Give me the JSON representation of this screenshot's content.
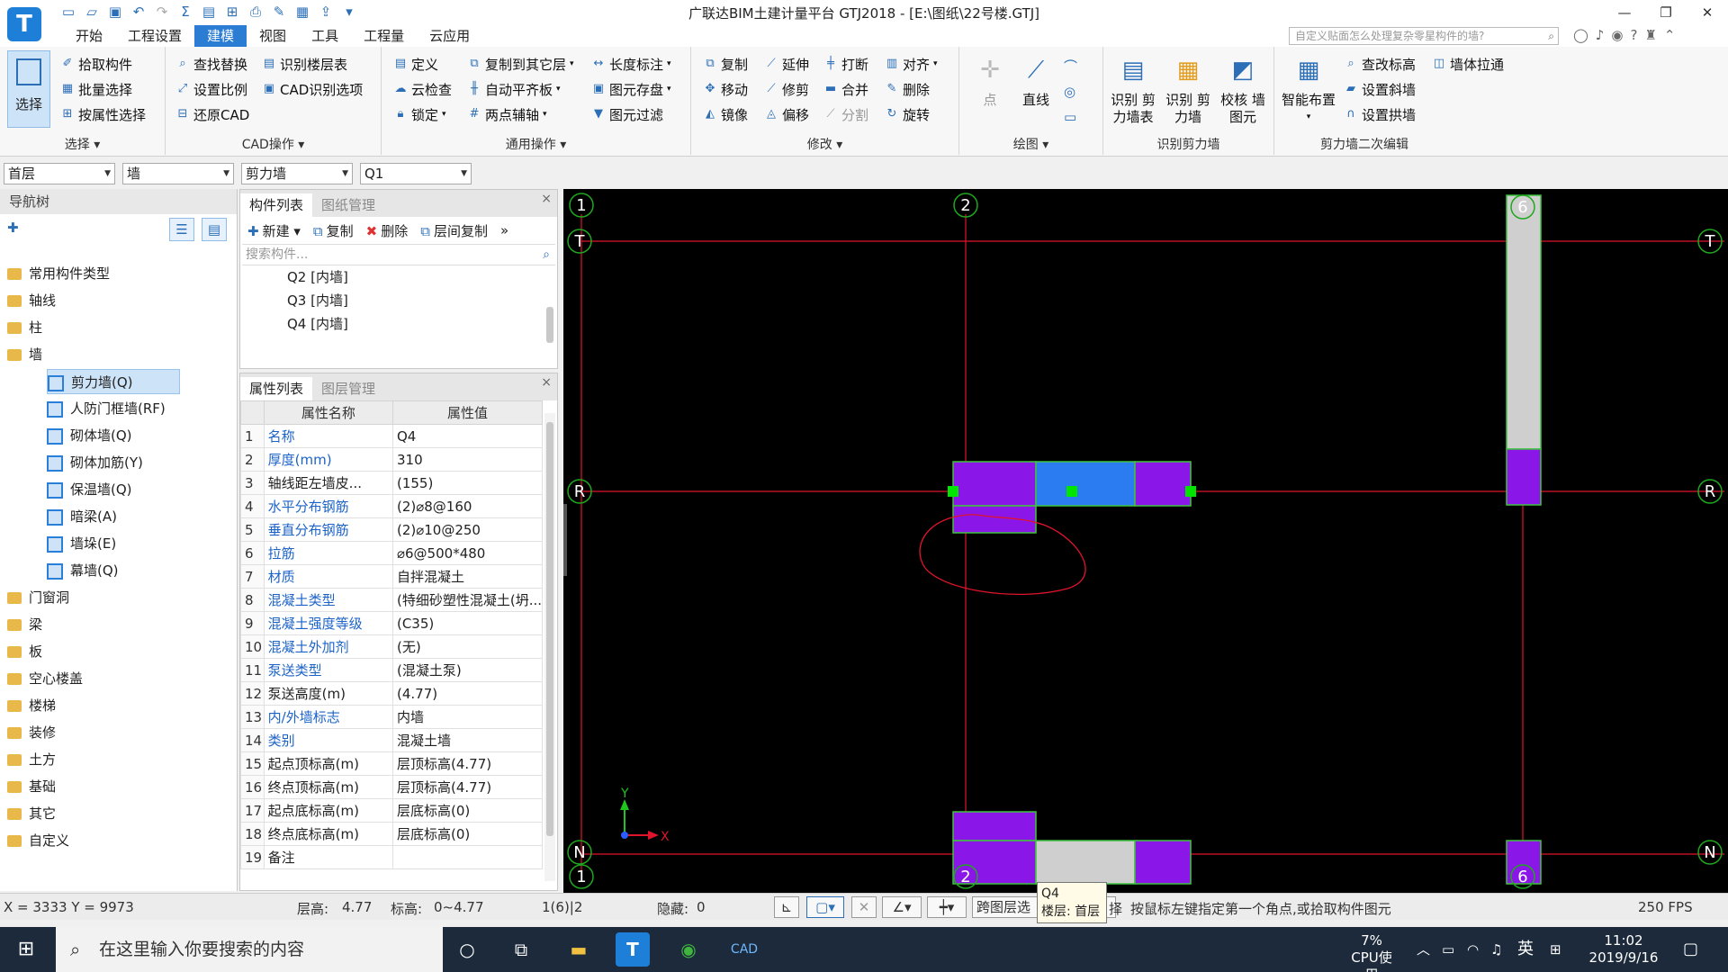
{
  "app": {
    "logo": "T",
    "title": "广联达BIM土建计量平台 GTJ2018 - [E:\\图纸\\22号楼.GTJ]",
    "window_controls": [
      "—",
      "❐",
      "✕"
    ]
  },
  "menu": {
    "tabs": [
      "开始",
      "工程设置",
      "建模",
      "视图",
      "工具",
      "工程量",
      "云应用"
    ],
    "active_tab": "建模",
    "help_placeholder": "自定义贴面怎么处理复杂零星构件的墙?",
    "help_question": "?"
  },
  "ribbon": {
    "select": {
      "big": "选择",
      "pick": "拾取构件",
      "batch": "批量选择",
      "byattr": "按属性选择",
      "label": "选择"
    },
    "cad": {
      "find": "查找替换",
      "scale": "设置比例",
      "restore": "还原CAD",
      "floor": "识别楼层表",
      "option": "CAD识别选项",
      "label": "CAD操作"
    },
    "common": {
      "define": "定义",
      "cloud": "云检查",
      "lock": "锁定",
      "copyto": "复制到其它层",
      "autoslab": "自动平齐板",
      "twopoint": "两点辅轴",
      "dim": "长度标注",
      "save": "图元存盘",
      "filter": "图元过滤",
      "label": "通用操作"
    },
    "modify": {
      "copy": "复制",
      "move": "移动",
      "mirror": "镜像",
      "extend": "延伸",
      "trim": "修剪",
      "offset": "偏移",
      "break": "打断",
      "merge": "合并",
      "split": "分割",
      "align": "对齐",
      "delete": "删除",
      "rotate": "旋转",
      "label": "修改"
    },
    "draw": {
      "point": "点",
      "line": "直线",
      "label": "绘图"
    },
    "recognize": {
      "table": "识别 剪力墙表",
      "wall": "识别 剪力墙",
      "check": "校核 墙图元",
      "label": "识别剪力墙"
    },
    "edit2": {
      "smart": "智能布置",
      "elev": "查改标高",
      "stretch": "墙体拉通",
      "slope": "设置斜墙",
      "arch": "设置拱墙",
      "label": "剪力墙二次编辑"
    }
  },
  "dropdowns": [
    "首层",
    "墙",
    "剪力墙",
    "Q1"
  ],
  "nav": {
    "header": "导航树",
    "items": [
      {
        "label": "常用构件类型",
        "type": "folder"
      },
      {
        "label": "轴线",
        "type": "folder"
      },
      {
        "label": "柱",
        "type": "folder"
      },
      {
        "label": "墙",
        "type": "folder"
      },
      {
        "label": "剪力墙(Q)",
        "type": "child",
        "selected": true
      },
      {
        "label": "人防门框墙(RF)",
        "type": "child"
      },
      {
        "label": "砌体墙(Q)",
        "type": "child"
      },
      {
        "label": "砌体加筋(Y)",
        "type": "child"
      },
      {
        "label": "保温墙(Q)",
        "type": "child"
      },
      {
        "label": "暗梁(A)",
        "type": "child"
      },
      {
        "label": "墙垛(E)",
        "type": "child"
      },
      {
        "label": "幕墙(Q)",
        "type": "child"
      },
      {
        "label": "门窗洞",
        "type": "folder"
      },
      {
        "label": "梁",
        "type": "folder"
      },
      {
        "label": "板",
        "type": "folder"
      },
      {
        "label": "空心楼盖",
        "type": "folder"
      },
      {
        "label": "楼梯",
        "type": "folder"
      },
      {
        "label": "装修",
        "type": "folder"
      },
      {
        "label": "土方",
        "type": "folder"
      },
      {
        "label": "基础",
        "type": "folder"
      },
      {
        "label": "其它",
        "type": "folder"
      },
      {
        "label": "自定义",
        "type": "folder"
      }
    ]
  },
  "components": {
    "tabs": [
      "构件列表",
      "图纸管理"
    ],
    "tools": [
      "新建",
      "复制",
      "删除",
      "层间复制"
    ],
    "search_placeholder": "搜索构件...",
    "items": [
      "Q2 [内墙]",
      "Q3 [内墙]",
      "Q4 [内墙]"
    ]
  },
  "properties": {
    "tabs": [
      "属性列表",
      "图层管理"
    ],
    "headers": [
      "属性名称",
      "属性值"
    ],
    "rows": [
      {
        "n": "1",
        "name": "名称",
        "value": "Q4",
        "blue": true
      },
      {
        "n": "2",
        "name": "厚度(mm)",
        "value": "310",
        "blue": true
      },
      {
        "n": "3",
        "name": "轴线距左墙皮...",
        "value": "(155)",
        "blue": false
      },
      {
        "n": "4",
        "name": "水平分布钢筋",
        "value": "(2)⌀8@160",
        "blue": true
      },
      {
        "n": "5",
        "name": "垂直分布钢筋",
        "value": "(2)⌀10@250",
        "blue": true
      },
      {
        "n": "6",
        "name": "拉筋",
        "value": "⌀6@500*480",
        "blue": true
      },
      {
        "n": "7",
        "name": "材质",
        "value": "自拌混凝土",
        "blue": true
      },
      {
        "n": "8",
        "name": "混凝土类型",
        "value": "(特细砂塑性混凝土(坍...",
        "blue": true
      },
      {
        "n": "9",
        "name": "混凝土强度等级",
        "value": "(C35)",
        "blue": true
      },
      {
        "n": "10",
        "name": "混凝土外加剂",
        "value": "(无)",
        "blue": true
      },
      {
        "n": "11",
        "name": "泵送类型",
        "value": "(混凝土泵)",
        "blue": true
      },
      {
        "n": "12",
        "name": "泵送高度(m)",
        "value": "(4.77)",
        "blue": false
      },
      {
        "n": "13",
        "name": "内/外墙标志",
        "value": "内墙",
        "blue": true
      },
      {
        "n": "14",
        "name": "类别",
        "value": "混凝土墙",
        "blue": true
      },
      {
        "n": "15",
        "name": "起点顶标高(m)",
        "value": "层顶标高(4.77)",
        "blue": false
      },
      {
        "n": "16",
        "name": "终点顶标高(m)",
        "value": "层顶标高(4.77)",
        "blue": false
      },
      {
        "n": "17",
        "name": "起点底标高(m)",
        "value": "层底标高(0)",
        "blue": false
      },
      {
        "n": "18",
        "name": "终点底标高(m)",
        "value": "层底标高(0)",
        "blue": false
      },
      {
        "n": "19",
        "name": "备注",
        "value": "",
        "blue": false
      }
    ]
  },
  "canvas": {
    "axis_labels": [
      "1",
      "2",
      "6",
      "T",
      "R",
      "N"
    ],
    "ucs_x": "X",
    "ucs_y": "Y",
    "colors": {
      "grid": "#e0142c",
      "wall_purple": "#8a17e8",
      "wall_blue": "#2a7cf0",
      "wall_gray": "#cfcfcf",
      "wall_outline": "#3fc43f",
      "grip": "#00e600"
    }
  },
  "tooltip": {
    "line1": "Q4",
    "line2": "楼层: 首层"
  },
  "status": {
    "coords": "X = 3333 Y = 9973",
    "floor_h_label": "层高:",
    "floor_h": "4.77",
    "elev_label": "标高:",
    "elev": "0~4.77",
    "axis": "1(6)|2",
    "hidden_label": "隐藏:",
    "hidden": "0",
    "cross_floor": "跨图层选",
    "cross_floor_tail": "择",
    "hint": "按鼠标左键指定第一个角点,或拾取构件图元",
    "fps": "250 FPS"
  },
  "taskbar": {
    "search": "在这里输入你要搜索的内容",
    "cpu_pct": "7%",
    "cpu_label": "CPU使用",
    "ime": "英",
    "time": "11:02",
    "date": "2019/9/16"
  }
}
